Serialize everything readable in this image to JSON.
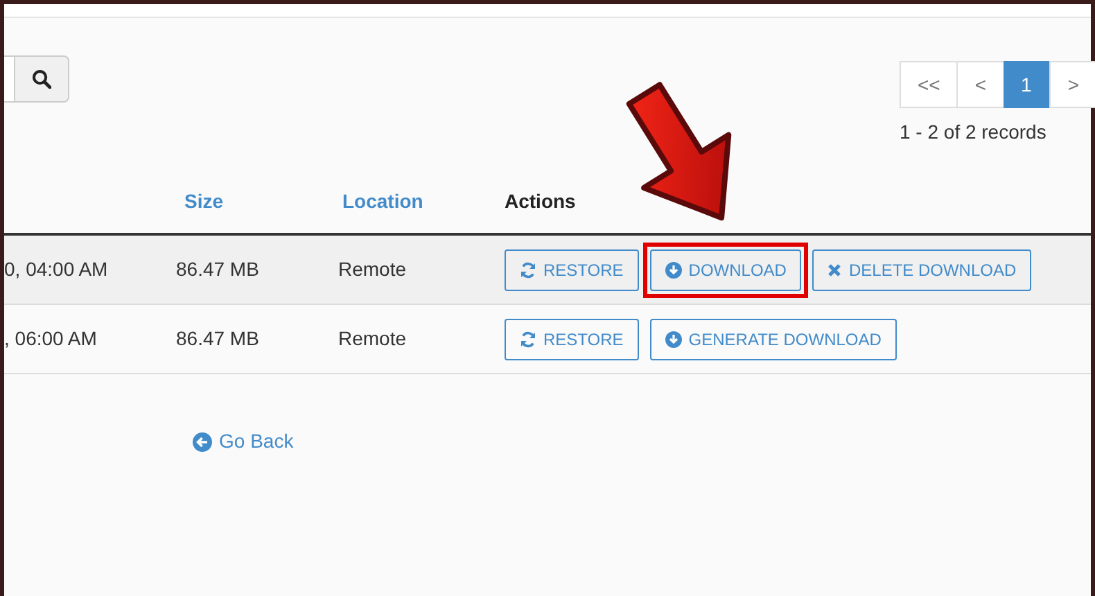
{
  "pagination": {
    "pages": [
      {
        "label": "<<",
        "selected": false
      },
      {
        "label": "<",
        "selected": false
      },
      {
        "label": "1",
        "selected": true
      },
      {
        "label": ">",
        "selected": false
      }
    ],
    "records": "1 - 2 of 2 records"
  },
  "table": {
    "columns": [
      {
        "kind": "blank"
      },
      {
        "label": "Size",
        "kind": "link"
      },
      {
        "label": "Location",
        "kind": "link"
      },
      {
        "label": "Actions",
        "kind": "plain"
      }
    ],
    "rows": [
      {
        "cells": [
          "0, 04:00 AM",
          "86.47 MB",
          "Remote"
        ],
        "actions": [
          {
            "label": "RESTORE",
            "kind": "restore",
            "highlighted": false
          },
          {
            "label": "DOWNLOAD",
            "kind": "download",
            "highlighted": true
          },
          {
            "label": "DELETE DOWNLOAD",
            "kind": "delete",
            "highlighted": false
          }
        ]
      },
      {
        "cells": [
          ", 06:00 AM",
          "86.47 MB",
          "Remote"
        ],
        "actions": [
          {
            "label": "RESTORE",
            "kind": "restore",
            "highlighted": false
          },
          {
            "label": "GENERATE DOWNLOAD",
            "kind": "download",
            "highlighted": false
          }
        ]
      }
    ]
  },
  "go_back": "Go Back"
}
